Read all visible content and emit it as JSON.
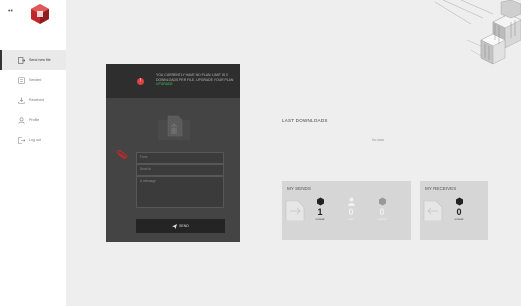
{
  "app": {
    "brand_color": "#c0282c"
  },
  "sidebar": {
    "toggle_icon": "dots-icon",
    "items": [
      {
        "label": "Send new file",
        "icon": "send-file-icon",
        "active": true
      },
      {
        "label": "Sended",
        "icon": "sended-icon",
        "active": false
      },
      {
        "label": "Received",
        "icon": "received-icon",
        "active": false
      },
      {
        "label": "Profile",
        "icon": "profile-icon",
        "active": false
      },
      {
        "label": "Log out",
        "icon": "logout-icon",
        "active": false
      }
    ]
  },
  "send_form": {
    "alert_badge": "!",
    "notice_text": "YOU CURRENTLY HAVE NO PLAN. LIMIT IS 0 DOWNLOADS PER FILE. UPGRADE YOUR PLAN",
    "notice_link": "UPGRADE",
    "from_placeholder": "From",
    "to_placeholder": "Send to",
    "message_placeholder": "A message",
    "send_label": "SEND"
  },
  "downloads": {
    "title": "LAST DOWNLOADS",
    "empty_text": "No data"
  },
  "my_sends": {
    "title": "MY SENDS",
    "stats": [
      {
        "value": "1",
        "label": "unread"
      },
      {
        "value": "0",
        "label": "read"
      },
      {
        "value": "0",
        "label": "expired"
      }
    ]
  },
  "my_receives": {
    "title": "MY RECEIVES",
    "stats": [
      {
        "value": "0",
        "label": "unread"
      }
    ]
  }
}
